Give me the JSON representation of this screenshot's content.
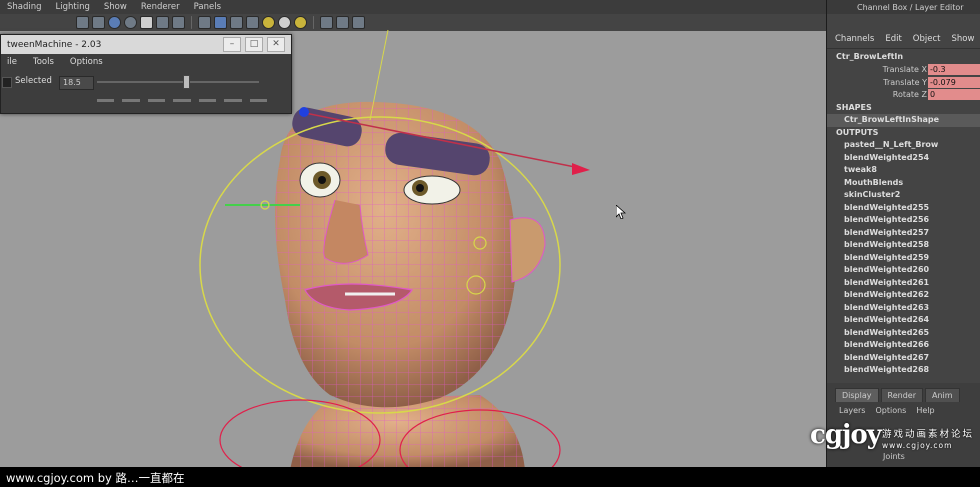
{
  "panel_menu": {
    "items": [
      "Shading",
      "Lighting",
      "Show",
      "Renderer",
      "Panels"
    ]
  },
  "tween_machine": {
    "title": "tweenMachine - 2.03",
    "window_buttons": [
      "–",
      "□",
      "✕"
    ],
    "menu": [
      "ile",
      "Tools",
      "Options"
    ],
    "selected_label": "Selected",
    "selected_value": "18.5",
    "slider_fraction": 0.55
  },
  "channel_box": {
    "header": "Channel Box / Layer Editor",
    "menu": [
      "Channels",
      "Edit",
      "Object",
      "Show"
    ],
    "object_name": "Ctr_BrowLeftIn",
    "attributes": [
      {
        "name": "Translate X",
        "value": "-0.3"
      },
      {
        "name": "Translate Y",
        "value": "-0.079"
      },
      {
        "name": "Rotate Z",
        "value": "0"
      }
    ],
    "shapes_label": "SHAPES",
    "shape_item": "Ctr_BrowLeftInShape",
    "outputs_label": "OUTPUTS",
    "outputs": [
      "pasted__N_Left_Brow",
      "blendWeighted254",
      "tweak8",
      "MouthBlends",
      "skinCluster2",
      "blendWeighted255",
      "blendWeighted256",
      "blendWeighted257",
      "blendWeighted258",
      "blendWeighted259",
      "blendWeighted260",
      "blendWeighted261",
      "blendWeighted262",
      "blendWeighted263",
      "blendWeighted264",
      "blendWeighted265",
      "blendWeighted266",
      "blendWeighted267",
      "blendWeighted268"
    ]
  },
  "layer_editor": {
    "tabs": [
      "Display",
      "Render",
      "Anim"
    ],
    "menu": [
      "Layers",
      "Options",
      "Help"
    ],
    "layers": [
      "Joints"
    ]
  },
  "watermark": {
    "logo": "cgjoy",
    "tagline": "游戏动画素材论坛",
    "url": "www.cgjoy.com"
  },
  "caption": "www.cgjoy.com by 路…一直都在",
  "colors": {
    "attr_highlight": "#e28c8c",
    "mesh": "#e058c8",
    "skin": "#c99a6e",
    "brow": "#55456e",
    "manip_yellow": "#d8d84a"
  }
}
